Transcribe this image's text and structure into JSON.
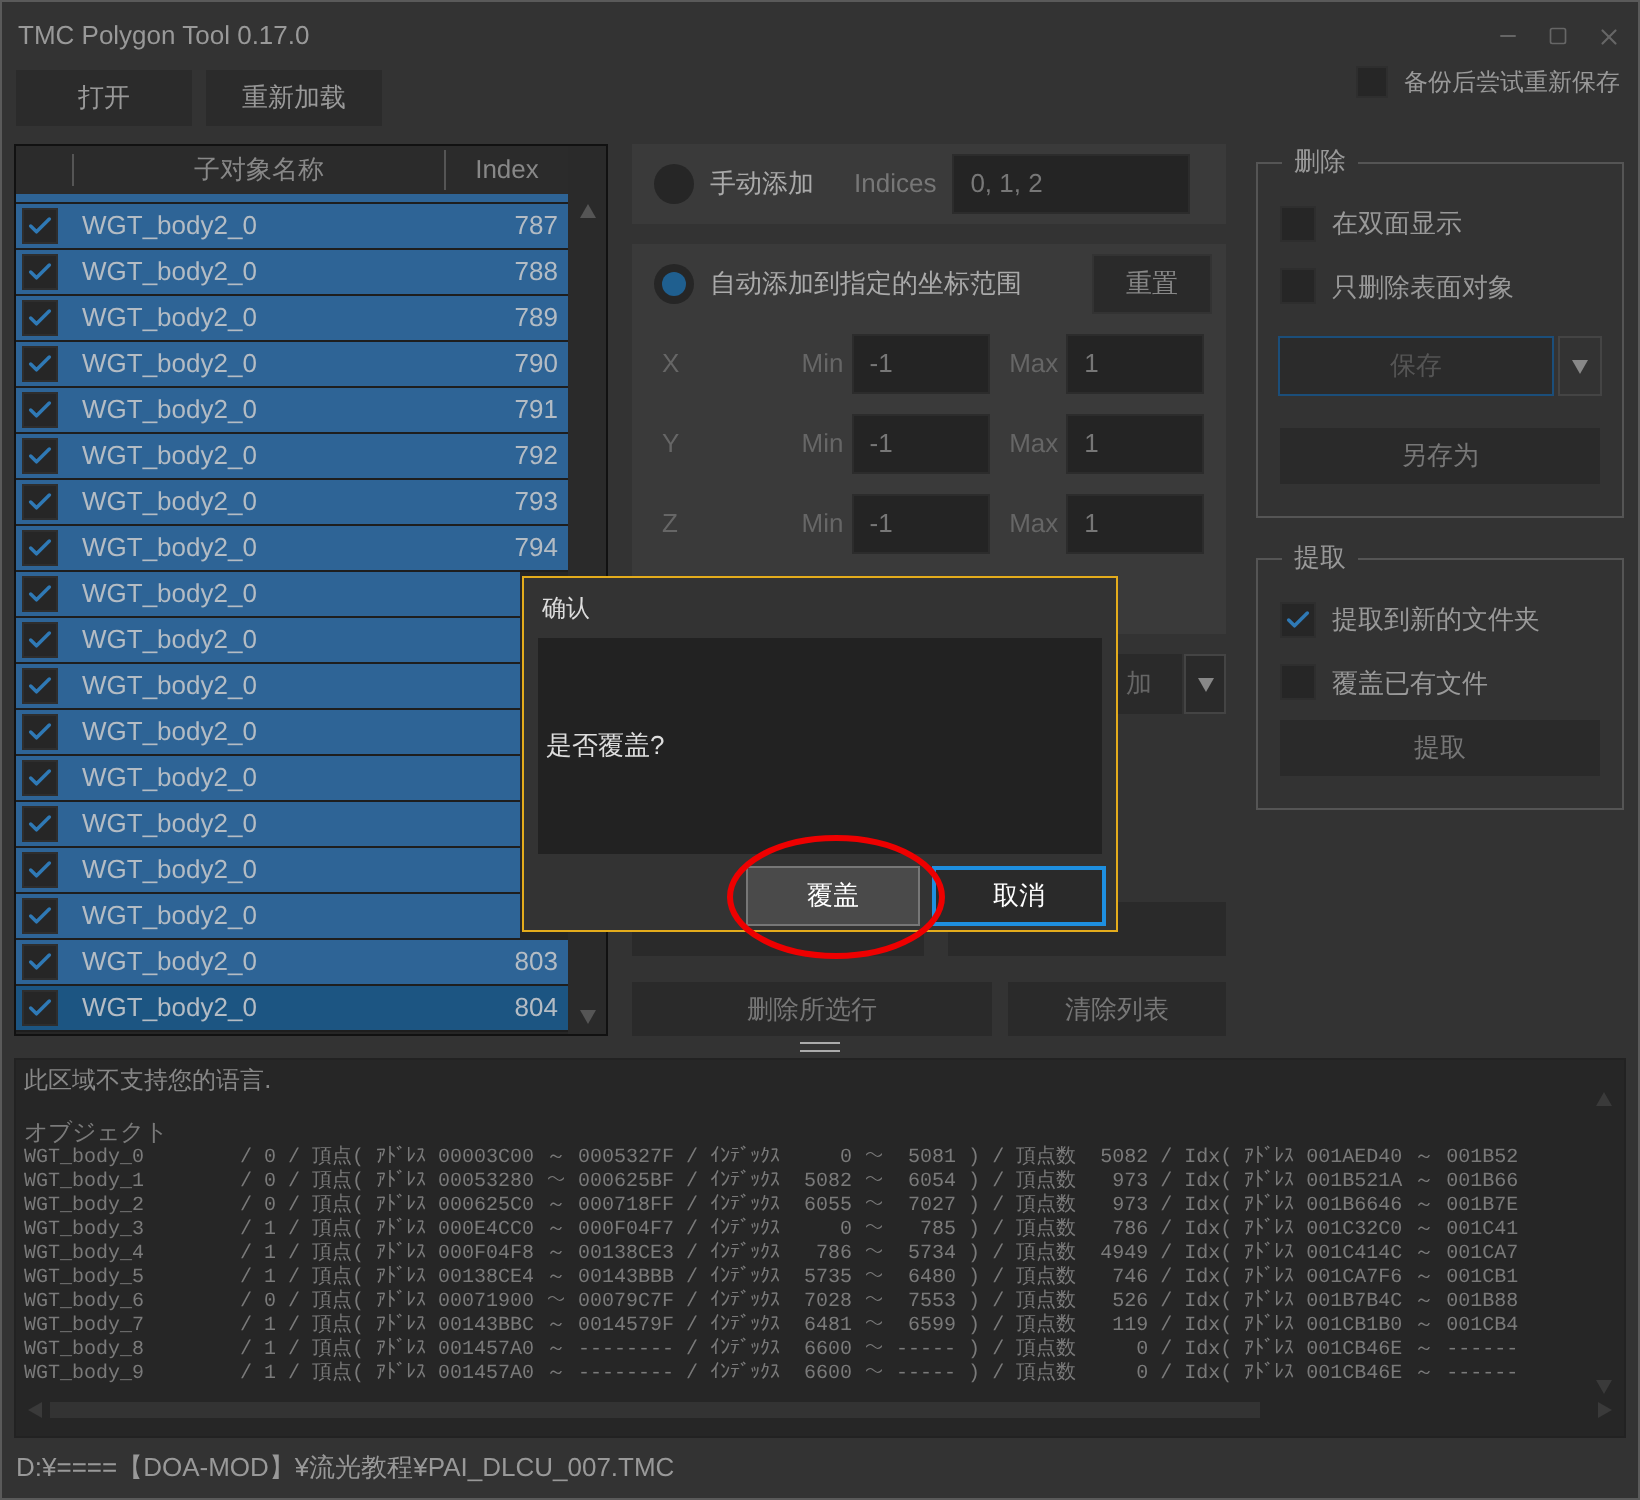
{
  "window": {
    "title": "TMC Polygon Tool 0.17.0"
  },
  "toolbar": {
    "buttons": [
      "打开",
      "重新加载"
    ],
    "backup_option": {
      "label": "备份后尝试重新保存",
      "checked": false
    }
  },
  "object_list": {
    "columns": [
      "子对象名称",
      "Index"
    ],
    "rows": [
      {
        "name": "WGT_body2_0",
        "index": "787",
        "checked": true,
        "selected": true,
        "focused": false
      },
      {
        "name": "WGT_body2_0",
        "index": "788",
        "checked": true,
        "selected": true,
        "focused": false
      },
      {
        "name": "WGT_body2_0",
        "index": "789",
        "checked": true,
        "selected": true,
        "focused": false
      },
      {
        "name": "WGT_body2_0",
        "index": "790",
        "checked": true,
        "selected": true,
        "focused": false
      },
      {
        "name": "WGT_body2_0",
        "index": "791",
        "checked": true,
        "selected": true,
        "focused": false
      },
      {
        "name": "WGT_body2_0",
        "index": "792",
        "checked": true,
        "selected": true,
        "focused": false
      },
      {
        "name": "WGT_body2_0",
        "index": "793",
        "checked": true,
        "selected": true,
        "focused": false
      },
      {
        "name": "WGT_body2_0",
        "index": "794",
        "checked": true,
        "selected": true,
        "focused": false
      },
      {
        "name": "WGT_body2_0",
        "checked": true,
        "selected": true,
        "focused": false
      },
      {
        "name": "WGT_body2_0",
        "checked": true,
        "selected": true,
        "focused": false
      },
      {
        "name": "WGT_body2_0",
        "checked": true,
        "selected": true,
        "focused": false
      },
      {
        "name": "WGT_body2_0",
        "checked": true,
        "selected": true,
        "focused": false
      },
      {
        "name": "WGT_body2_0",
        "checked": true,
        "selected": true,
        "focused": false
      },
      {
        "name": "WGT_body2_0",
        "checked": true,
        "selected": true,
        "focused": false
      },
      {
        "name": "WGT_body2_0",
        "checked": true,
        "selected": true,
        "focused": false
      },
      {
        "name": "WGT_body2_0",
        "checked": true,
        "selected": true,
        "focused": false
      },
      {
        "name": "WGT_body2_0",
        "index": "803",
        "checked": true,
        "selected": true,
        "focused": false
      },
      {
        "name": "WGT_body2_0",
        "index": "804",
        "checked": true,
        "selected": true,
        "focused": true
      }
    ]
  },
  "manual_add": {
    "label": "手动添加",
    "selected": false,
    "indices_label": "Indices",
    "indices_value": "0, 1, 2"
  },
  "auto_add": {
    "label": "自动添加到指定的坐标范围",
    "selected": true,
    "reset_button": "重置",
    "axes": [
      {
        "axis": "X",
        "min_label": "Min",
        "min": "-1",
        "max_label": "Max",
        "max": "1"
      },
      {
        "axis": "Y",
        "min_label": "Min",
        "min": "-1",
        "max_label": "Max",
        "max": "1"
      },
      {
        "axis": "Z",
        "min_label": "Min",
        "min": "-1",
        "max_label": "Max",
        "max": "1"
      }
    ]
  },
  "mode_dropdown": {
    "value": "加"
  },
  "list_buttons": [
    "删除所选行",
    "清除列表"
  ],
  "delete_group": {
    "title": "删除",
    "options": [
      {
        "label": "在双面显示",
        "checked": false
      },
      {
        "label": "只删除表面对象",
        "checked": false
      }
    ],
    "save_button": "保存",
    "save_as_button": "另存为"
  },
  "extract_group": {
    "title": "提取",
    "options": [
      {
        "label": "提取到新的文件夹",
        "checked": true
      },
      {
        "label": "覆盖已有文件",
        "checked": false
      }
    ],
    "extract_button": "提取"
  },
  "log": {
    "notice": "此区域不支持您的语言.",
    "heading": "オブジェクト",
    "lines": [
      "WGT_body_0        / 0 / 頂点( ｱﾄﾞﾚｽ 00003C00 ～ 0005327F / ｲﾝﾃﾞｯｸｽ     0 ～  5081 ) / 頂点数  5082 / Idx( ｱﾄﾞﾚｽ 001AED40 ～ 001B52",
      "WGT_body_1        / 0 / 頂点( ｱﾄﾞﾚｽ 00053280 ～ 000625BF / ｲﾝﾃﾞｯｸｽ  5082 ～  6054 ) / 頂点数   973 / Idx( ｱﾄﾞﾚｽ 001B521A ～ 001B66",
      "WGT_body_2        / 0 / 頂点( ｱﾄﾞﾚｽ 000625C0 ～ 000718FF / ｲﾝﾃﾞｯｸｽ  6055 ～  7027 ) / 頂点数   973 / Idx( ｱﾄﾞﾚｽ 001B6646 ～ 001B7E",
      "WGT_body_3        / 1 / 頂点( ｱﾄﾞﾚｽ 000E4CC0 ～ 000F04F7 / ｲﾝﾃﾞｯｸｽ     0 ～   785 ) / 頂点数   786 / Idx( ｱﾄﾞﾚｽ 001C32C0 ～ 001C41",
      "WGT_body_4        / 1 / 頂点( ｱﾄﾞﾚｽ 000F04F8 ～ 00138CE3 / ｲﾝﾃﾞｯｸｽ   786 ～  5734 ) / 頂点数  4949 / Idx( ｱﾄﾞﾚｽ 001C414C ～ 001CA7",
      "WGT_body_5        / 1 / 頂点( ｱﾄﾞﾚｽ 00138CE4 ～ 00143BBB / ｲﾝﾃﾞｯｸｽ  5735 ～  6480 ) / 頂点数   746 / Idx( ｱﾄﾞﾚｽ 001CA7F6 ～ 001CB1",
      "WGT_body_6        / 0 / 頂点( ｱﾄﾞﾚｽ 00071900 ～ 00079C7F / ｲﾝﾃﾞｯｸｽ  7028 ～  7553 ) / 頂点数   526 / Idx( ｱﾄﾞﾚｽ 001B7B4C ～ 001B88",
      "WGT_body_7        / 1 / 頂点( ｱﾄﾞﾚｽ 00143BBC ～ 0014579F / ｲﾝﾃﾞｯｸｽ  6481 ～  6599 ) / 頂点数   119 / Idx( ｱﾄﾞﾚｽ 001CB1B0 ～ 001CB4",
      "WGT_body_8        / 1 / 頂点( ｱﾄﾞﾚｽ 001457A0 ～ -------- / ｲﾝﾃﾞｯｸｽ  6600 ～ ----- ) / 頂点数     0 / Idx( ｱﾄﾞﾚｽ 001CB46E ～ ------",
      "WGT_body_9        / 1 / 頂点( ｱﾄﾞﾚｽ 001457A0 ～ -------- / ｲﾝﾃﾞｯｸｽ  6600 ～ ----- ) / 頂点数     0 / Idx( ｱﾄﾞﾚｽ 001CB46E ～ ------"
    ]
  },
  "status_bar": {
    "path": "D:¥====【DOA-MOD】¥流光教程¥PAI_DLCU_007.TMC"
  },
  "dialog": {
    "title": "确认",
    "message": "是否覆盖?",
    "buttons": [
      {
        "label": "覆盖",
        "kind": "primary"
      },
      {
        "label": "取消",
        "kind": "focused"
      }
    ]
  }
}
